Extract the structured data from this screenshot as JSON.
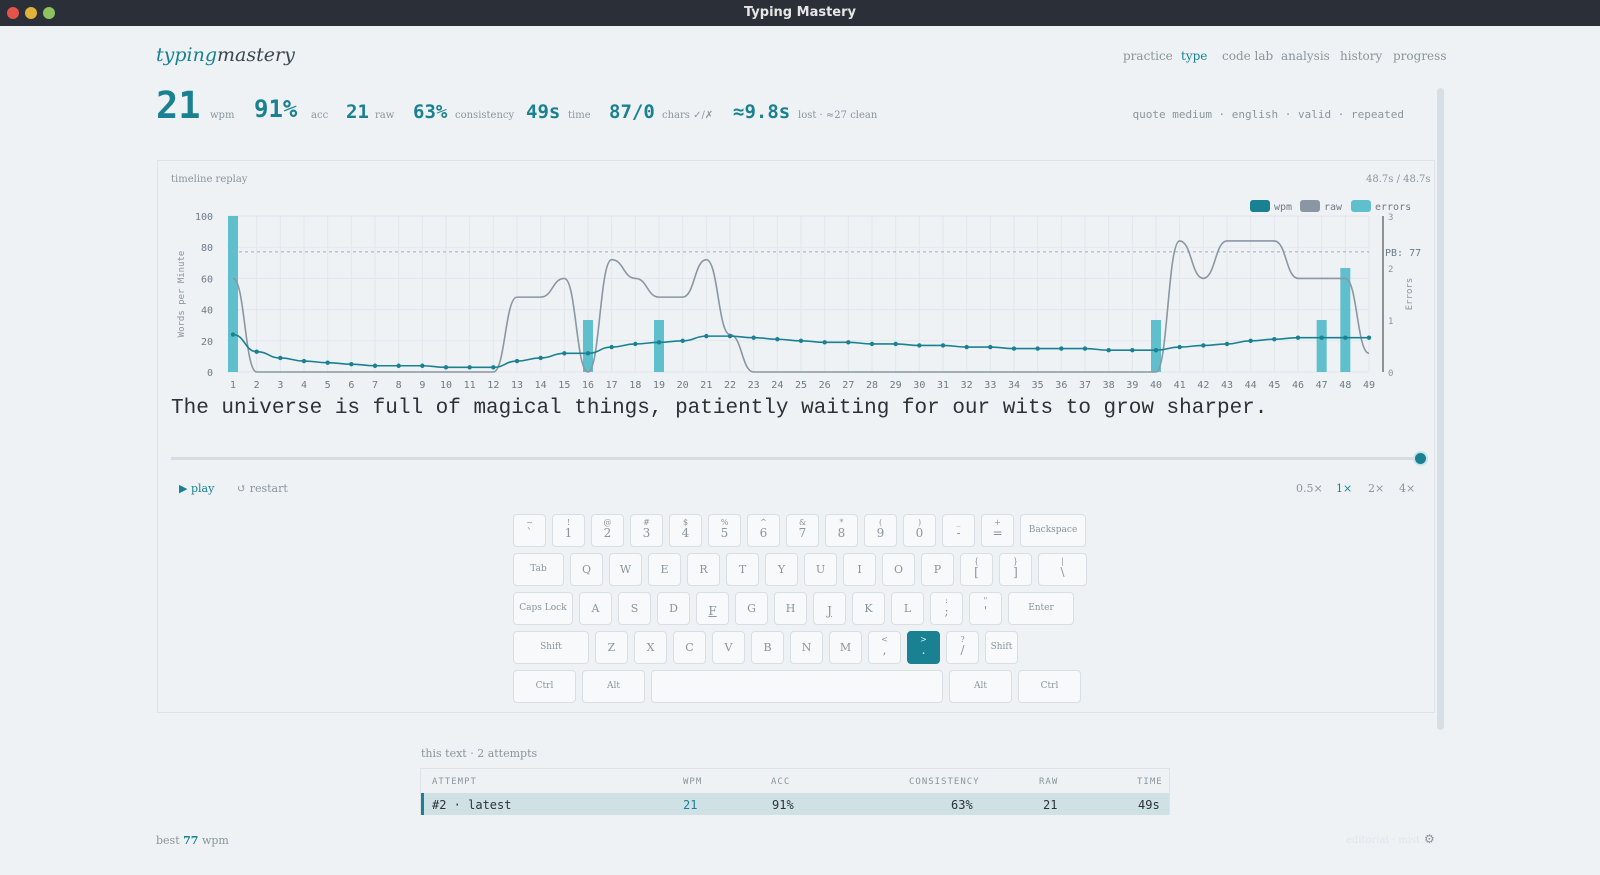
{
  "window": {
    "title": "Typing Mastery"
  },
  "logo": {
    "part1": "typing",
    "part2": "mastery"
  },
  "nav": [
    "practice",
    "type",
    "code lab",
    "analysis",
    "history",
    "progress"
  ],
  "stats": {
    "wpm": {
      "value": "21",
      "label": "wpm"
    },
    "acc": {
      "value": "91%",
      "label": "acc"
    },
    "raw": {
      "value": "21",
      "label": "raw"
    },
    "consistency": {
      "value": "63%",
      "label": "consistency"
    },
    "time": {
      "value": "49s",
      "label": "time"
    },
    "chars": {
      "value": "87/0",
      "label": "chars ✓/✗"
    },
    "lost": {
      "value": "≈9.8s",
      "label": "lost · ≈27 clean"
    }
  },
  "tags": "quote medium · english · valid · repeated",
  "timeline": {
    "title": "timeline replay",
    "time_readout": "48.7s / 48.7s"
  },
  "chart_data": {
    "type": "line",
    "x": [
      1,
      2,
      3,
      4,
      5,
      6,
      7,
      8,
      9,
      10,
      11,
      12,
      13,
      14,
      15,
      16,
      17,
      18,
      19,
      20,
      21,
      22,
      23,
      24,
      25,
      26,
      27,
      28,
      29,
      30,
      31,
      32,
      33,
      34,
      35,
      36,
      37,
      38,
      39,
      40,
      41,
      42,
      43,
      44,
      45,
      46,
      47,
      48,
      49
    ],
    "series": [
      {
        "name": "wpm",
        "values": [
          24,
          13,
          9,
          7,
          6,
          5,
          4,
          4,
          4,
          3,
          3,
          3,
          7,
          9,
          12,
          12,
          16,
          18,
          19,
          20,
          23,
          23,
          22,
          21,
          20,
          19,
          19,
          18,
          18,
          17,
          17,
          16,
          16,
          15,
          15,
          15,
          15,
          14,
          14,
          14,
          16,
          17,
          18,
          20,
          21,
          22,
          22,
          22,
          22
        ]
      },
      {
        "name": "raw",
        "values": [
          60,
          0,
          0,
          0,
          0,
          0,
          0,
          0,
          0,
          0,
          0,
          0,
          48,
          48,
          60,
          0,
          72,
          60,
          48,
          48,
          72,
          24,
          0,
          0,
          0,
          0,
          0,
          0,
          0,
          0,
          0,
          0,
          0,
          0,
          0,
          0,
          0,
          0,
          0,
          0,
          84,
          60,
          84,
          84,
          84,
          60,
          60,
          60,
          12
        ]
      },
      {
        "name": "errors",
        "values": [
          3,
          0,
          0,
          0,
          0,
          0,
          0,
          0,
          0,
          0,
          0,
          0,
          0,
          0,
          0,
          1,
          0,
          0,
          1,
          0,
          0,
          0,
          0,
          0,
          0,
          0,
          0,
          0,
          0,
          0,
          0,
          0,
          0,
          0,
          0,
          0,
          0,
          0,
          0,
          1,
          0,
          0,
          0,
          0,
          0,
          0,
          1,
          2,
          0
        ]
      }
    ],
    "ylabel": "Words per Minute",
    "y2label": "Errors",
    "ylim": [
      0,
      100
    ],
    "y2lim": [
      0,
      3
    ],
    "yticks": [
      0,
      20,
      40,
      60,
      80,
      100
    ],
    "y2ticks": [
      0,
      1,
      2,
      3
    ],
    "reference_line": {
      "value": 77,
      "label": "PB: 77"
    },
    "legend": [
      "wpm",
      "raw",
      "errors"
    ],
    "legend_position": "top-right",
    "colors": {
      "wpm": "#1a8192",
      "raw": "#8a96a3",
      "errors": "#5fbfcc"
    },
    "grid": true
  },
  "quote": "The universe is full of magical things, patiently waiting for our wits to grow sharper.",
  "replay_progress": 1.0,
  "controls": {
    "play": "▶ play",
    "restart": "↺ restart",
    "speeds": [
      "0.5×",
      "1×",
      "2×",
      "4×"
    ],
    "active_speed": "1×"
  },
  "keyboard": {
    "highlighted": ".",
    "rows": [
      [
        {
          "t": "~",
          "b": "`"
        },
        {
          "t": "!",
          "b": "1"
        },
        {
          "t": "@",
          "b": "2"
        },
        {
          "t": "#",
          "b": "3"
        },
        {
          "t": "$",
          "b": "4"
        },
        {
          "t": "%",
          "b": "5"
        },
        {
          "t": "^",
          "b": "6"
        },
        {
          "t": "&",
          "b": "7"
        },
        {
          "t": "*",
          "b": "8"
        },
        {
          "t": "(",
          "b": "9"
        },
        {
          "t": ")",
          "b": "0"
        },
        {
          "t": "_",
          "b": "-"
        },
        {
          "t": "+",
          "b": "="
        },
        {
          "c": "Backspace"
        }
      ],
      [
        {
          "c": "Tab"
        },
        {
          "c": "Q"
        },
        {
          "c": "W"
        },
        {
          "c": "E"
        },
        {
          "c": "R"
        },
        {
          "c": "T"
        },
        {
          "c": "Y"
        },
        {
          "c": "U"
        },
        {
          "c": "I"
        },
        {
          "c": "O"
        },
        {
          "c": "P"
        },
        {
          "t": "{",
          "b": "["
        },
        {
          "t": "}",
          "b": "]"
        },
        {
          "t": "|",
          "b": "\\"
        }
      ],
      [
        {
          "c": "Caps Lock"
        },
        {
          "c": "A"
        },
        {
          "c": "S"
        },
        {
          "c": "D"
        },
        {
          "t": "",
          "b": "F"
        },
        {
          "c": "G"
        },
        {
          "c": "H"
        },
        {
          "t": "",
          "b": "J"
        },
        {
          "c": "K"
        },
        {
          "c": "L"
        },
        {
          "t": ":",
          "b": ";"
        },
        {
          "t": "\"",
          "b": "'"
        },
        {
          "c": "Enter"
        }
      ],
      [
        {
          "c": "Shift"
        },
        {
          "c": "Z"
        },
        {
          "c": "X"
        },
        {
          "c": "C"
        },
        {
          "c": "V"
        },
        {
          "c": "B"
        },
        {
          "c": "N"
        },
        {
          "c": "M"
        },
        {
          "t": "<",
          "b": ","
        },
        {
          "t": ">",
          "b": "."
        },
        {
          "t": "?",
          "b": "/"
        },
        {
          "c": "Shift"
        }
      ],
      [
        {
          "c": "Ctrl"
        },
        {
          "c": "Alt"
        },
        {
          "c": ""
        },
        {
          "c": "Alt"
        },
        {
          "c": "Ctrl"
        }
      ]
    ]
  },
  "attempts": {
    "title": "this text · 2 attempts",
    "headers": [
      "ATTEMPT",
      "WPM",
      "ACC",
      "CONSISTENCY",
      "RAW",
      "TIME"
    ],
    "rows": [
      {
        "attempt": "#2 · latest",
        "wpm": "21",
        "acc": "91%",
        "consistency": "63%",
        "raw": "21",
        "time": "49s"
      }
    ]
  },
  "footer": {
    "best_prefix": "best",
    "best_value": "77",
    "best_suffix": "wpm",
    "right_text": "editorial · mist",
    "settings_icon": "gear-icon"
  }
}
